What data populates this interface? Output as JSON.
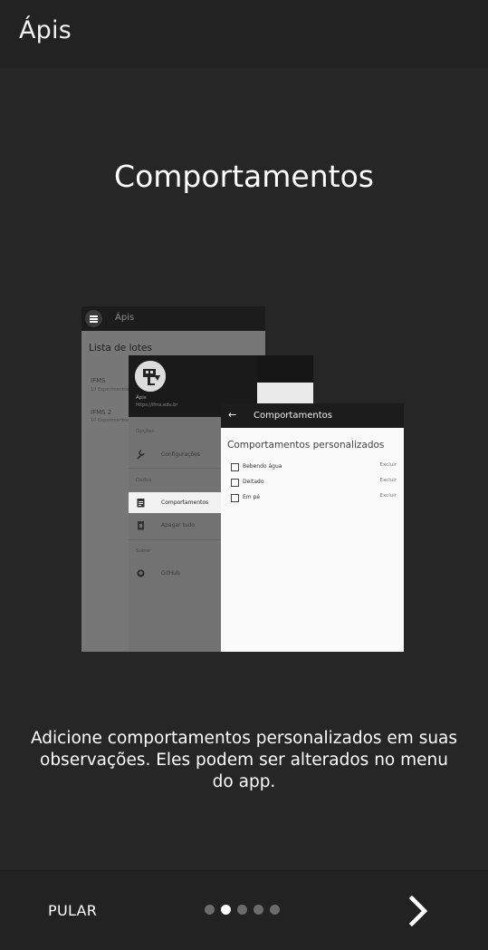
{
  "appbar": {
    "title": "Ápis"
  },
  "slide": {
    "title": "Comportamentos",
    "description": "Adicione comportamentos personalizados em suas observações. Eles podem ser alterados no menu do app."
  },
  "illustration": {
    "main_screen": {
      "app_title": "Ápis",
      "list_title": "Lista de lotes",
      "items": [
        {
          "name": "IFMS",
          "sub": "10 Experimentos"
        },
        {
          "name": "IFMS 2",
          "sub": "10 Experimentos"
        }
      ]
    },
    "drawer": {
      "app_name": "Ápis",
      "email": "https://ifms.edu.br",
      "sections": [
        "Opções",
        "Dados",
        "Sobre"
      ],
      "items": [
        "Configurações",
        "Comportamentos",
        "Apagar tudo",
        "GitHub"
      ]
    },
    "behaviors_screen": {
      "title": "Comportamentos",
      "heading": "Comportamentos personalizados",
      "rows": [
        {
          "label": "Bebendo água",
          "action": "Excluir"
        },
        {
          "label": "Deitado",
          "action": "Excluir"
        },
        {
          "label": "Em pé",
          "action": "Excluir"
        }
      ]
    }
  },
  "footer": {
    "skip_label": "PULAR",
    "page_count": 5,
    "current_page": 2,
    "next_icon": "chevron-right-icon"
  },
  "colors": {
    "background": "#262626",
    "bar": "#222222",
    "dot_active": "#ffffff",
    "dot_inactive": "#6b6b6b"
  }
}
